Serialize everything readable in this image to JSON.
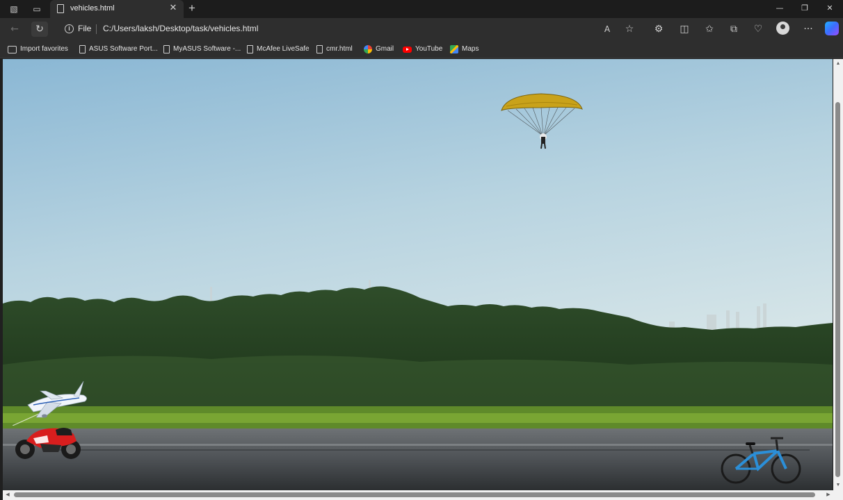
{
  "browser": {
    "tab": {
      "title": "vehicles.html",
      "close_glyph": "✕"
    },
    "new_tab_glyph": "+",
    "window_controls": {
      "minimize": "—",
      "restore": "❐",
      "close": "✕"
    },
    "address": {
      "scheme_label": "File",
      "url": "C:/Users/laksh/Desktop/task/vehicles.html"
    },
    "nav": {
      "back": "←",
      "refresh": "↻"
    },
    "toolbar_icons": [
      "read-aloud-icon",
      "favorite-star-icon",
      "extensions-icon",
      "split-screen-icon",
      "favorites-icon",
      "collections-icon",
      "browser-essentials-icon",
      "profile-icon",
      "more-menu-icon",
      "copilot-icon"
    ],
    "toolbar_glyphs": {
      "read_aloud": "A",
      "favorite": "☆",
      "extensions": "⚙",
      "split": "◫",
      "favorites": "✩",
      "collections": "⧉",
      "essentials": "♡",
      "more": "···"
    }
  },
  "favorites": [
    {
      "label": "Import favorites",
      "icon": "import"
    },
    {
      "label": "ASUS Software Port...",
      "icon": "page"
    },
    {
      "label": "MyASUS Software -...",
      "icon": "page"
    },
    {
      "label": "McAfee LiveSafe",
      "icon": "page"
    },
    {
      "label": "cmr.html",
      "icon": "page"
    },
    {
      "label": "Gmail",
      "icon": "google"
    },
    {
      "label": "YouTube",
      "icon": "yt"
    },
    {
      "label": "Maps",
      "icon": "maps"
    }
  ],
  "scene": {
    "background": "sky-treeline-road-photo",
    "vehicles": [
      "paraglider",
      "airplane",
      "motorcycle",
      "bicycle"
    ],
    "colors": {
      "sky_top": "#8fbad6",
      "sky_bottom": "#dde8ea",
      "trees": "#24401f",
      "grass": "#6f9a2c",
      "road": "#4a4e52",
      "canopy": "#c9a21a",
      "plane": "#f2f6fb",
      "bike_red": "#d81e1e",
      "bicycle_blue": "#2b8fd8"
    }
  }
}
